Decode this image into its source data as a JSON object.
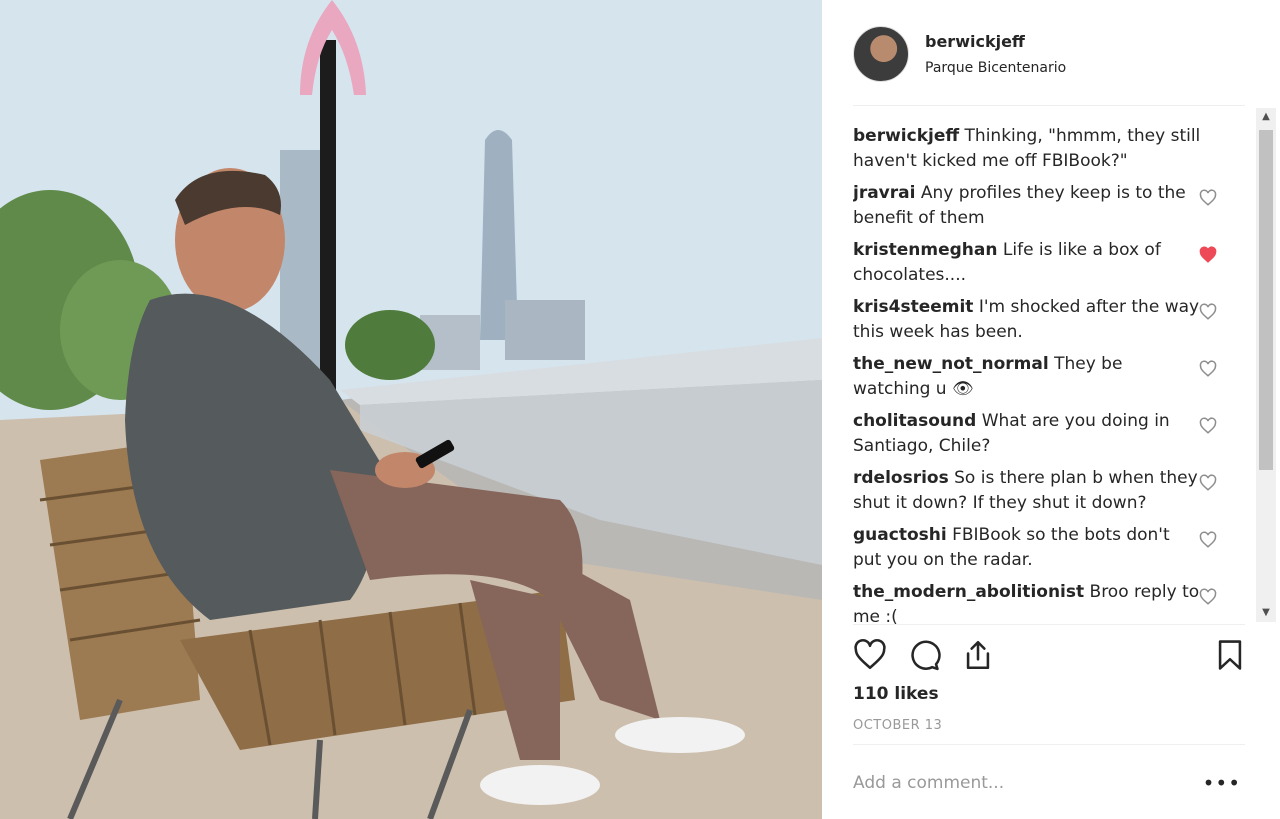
{
  "post": {
    "username": "berwickjeff",
    "location": "Parque Bicentenario"
  },
  "comments": [
    {
      "user": "berwickjeff",
      "text": "Thinking, \"hmmm, they still haven't kicked me off FBIBook?\"",
      "liked": null
    },
    {
      "user": "jravrai",
      "text": "Any profiles they keep is to the benefit of them",
      "liked": false
    },
    {
      "user": "kristenmeghan",
      "text": "Life is like a box of chocolates....",
      "liked": true
    },
    {
      "user": "kris4steemit",
      "text": "I'm shocked after the way this week has been.",
      "liked": false
    },
    {
      "user": "the_new_not_normal",
      "text": "They be watching u 👁",
      "liked": false
    },
    {
      "user": "cholitasound",
      "text": "What are you doing in Santiago, Chile?",
      "liked": false
    },
    {
      "user": "rdelosrios",
      "text": "So is there plan b when they shut it down? If they shut it down?",
      "liked": false
    },
    {
      "user": "guactoshi",
      "text": "FBIBook so the bots don't put you on the radar.",
      "liked": false
    },
    {
      "user": "the_modern_abolitionist",
      "text": "Broo reply to me :(",
      "liked": false
    }
  ],
  "actions": {
    "icons": [
      "heart-icon",
      "comment-icon",
      "share-icon",
      "bookmark-icon"
    ]
  },
  "likes": "110 likes",
  "date": "OCTOBER 13",
  "comment_input": {
    "placeholder": "Add a comment..."
  },
  "more_label": "•••",
  "colors": {
    "liked_heart": "#ed4956",
    "text": "#262626",
    "muted": "#999999",
    "divider": "#efefef"
  }
}
